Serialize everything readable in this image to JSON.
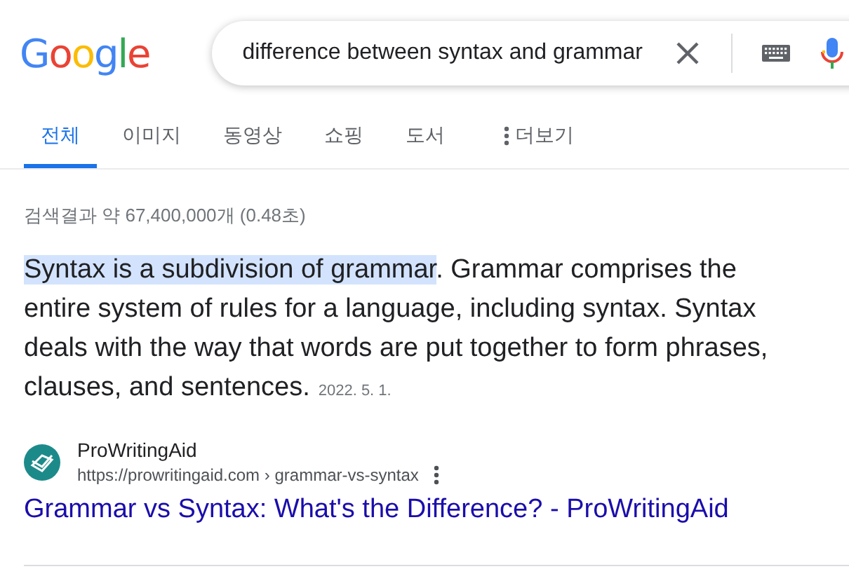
{
  "logo": "Google",
  "search": {
    "value": "difference between syntax and grammar"
  },
  "tabs": [
    {
      "label": "전체",
      "selected": true
    },
    {
      "label": "이미지",
      "selected": false
    },
    {
      "label": "동영상",
      "selected": false
    },
    {
      "label": "쇼핑",
      "selected": false
    },
    {
      "label": "도서",
      "selected": false
    },
    {
      "label": "더보기",
      "selected": false,
      "kind": "more"
    }
  ],
  "result_stats": "검색결과 약 67,400,000개 (0.48초)",
  "snippet": {
    "highlight": "Syntax is a subdivision of grammar",
    "text": ". Grammar comprises the entire system of rules for a language, including syntax. Syntax deals with the way that words are put together to form phrases, clauses, and sentences.",
    "date": "2022. 5. 1."
  },
  "result": {
    "site": "ProWritingAid",
    "url": "https://prowritingaid.com",
    "path": "› grammar-vs-syntax",
    "title": "Grammar vs Syntax: What's the Difference? - ProWritingAid"
  }
}
